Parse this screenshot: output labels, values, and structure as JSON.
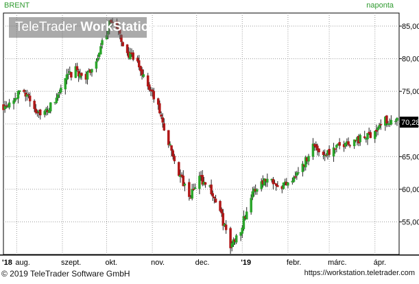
{
  "header": {
    "symbol": "BRENT",
    "period": "naponta"
  },
  "watermark": {
    "brand_light": "TeleTrader ",
    "brand_bold": "WorkStation"
  },
  "footer": {
    "copyright": "© 2019 TeleTrader Software GmbH",
    "url": "https://workstation.teletrader.com"
  },
  "colors": {
    "up": "#2aa52a",
    "down": "#b01818",
    "grid": "#9a9a9a",
    "axis": "#000000",
    "symbol": "#2e9a2e"
  },
  "chart_data": {
    "type": "candlestick",
    "ylim": [
      50,
      87
    ],
    "y_ticks": [
      {
        "value": 55,
        "label": "55,00"
      },
      {
        "value": 60,
        "label": "60,00"
      },
      {
        "value": 65,
        "label": "65,00"
      },
      {
        "value": 70,
        "label": "70,00"
      },
      {
        "value": 75,
        "label": "75,00"
      },
      {
        "value": 80,
        "label": "80,00"
      },
      {
        "value": 85,
        "label": "85,00"
      }
    ],
    "x_ticks": [
      {
        "date": "2018-07-23",
        "label": "'18",
        "bold": true
      },
      {
        "date": "2018-08-01",
        "label": "aug.",
        "bold": false
      },
      {
        "date": "2018-09-01",
        "label": "szept.",
        "bold": false
      },
      {
        "date": "2018-10-01",
        "label": "okt.",
        "bold": false
      },
      {
        "date": "2018-11-01",
        "label": "nov.",
        "bold": false
      },
      {
        "date": "2018-12-01",
        "label": "dec.",
        "bold": false
      },
      {
        "date": "2019-01-01",
        "label": "'19",
        "bold": true
      },
      {
        "date": "2019-02-01",
        "label": "febr.",
        "bold": false
      },
      {
        "date": "2019-03-01",
        "label": "márc.",
        "bold": false
      },
      {
        "date": "2019-04-01",
        "label": "ápr.",
        "bold": false
      }
    ],
    "x_range": [
      "2018-07-23",
      "2019-04-16"
    ],
    "last_price": {
      "value": 70.28,
      "label": "70,28"
    },
    "grid": true,
    "close_path": [
      [
        "2018-07-23",
        72.8
      ],
      [
        "2018-07-30",
        74.0
      ],
      [
        "2018-08-06",
        75.2
      ],
      [
        "2018-08-13",
        72.3
      ],
      [
        "2018-08-20",
        71.6
      ],
      [
        "2018-08-27",
        73.5
      ],
      [
        "2018-09-03",
        76.8
      ],
      [
        "2018-09-10",
        78.2
      ],
      [
        "2018-09-17",
        77.0
      ],
      [
        "2018-09-24",
        79.8
      ],
      [
        "2018-10-01",
        84.0
      ],
      [
        "2018-10-03",
        86.1
      ],
      [
        "2018-10-08",
        84.5
      ],
      [
        "2018-10-15",
        80.8
      ],
      [
        "2018-10-22",
        79.2
      ],
      [
        "2018-10-29",
        76.0
      ],
      [
        "2018-11-05",
        72.5
      ],
      [
        "2018-11-12",
        67.0
      ],
      [
        "2018-11-19",
        62.5
      ],
      [
        "2018-11-26",
        58.6
      ],
      [
        "2018-12-03",
        61.8
      ],
      [
        "2018-12-10",
        60.2
      ],
      [
        "2018-12-17",
        56.5
      ],
      [
        "2018-12-24",
        51.2
      ],
      [
        "2018-12-31",
        54.0
      ],
      [
        "2019-01-07",
        58.9
      ],
      [
        "2019-01-14",
        61.3
      ],
      [
        "2019-01-21",
        61.6
      ],
      [
        "2019-01-28",
        60.5
      ],
      [
        "2019-02-04",
        61.8
      ],
      [
        "2019-02-11",
        63.5
      ],
      [
        "2019-02-18",
        66.8
      ],
      [
        "2019-02-25",
        65.4
      ],
      [
        "2019-03-04",
        66.0
      ],
      [
        "2019-03-11",
        67.0
      ],
      [
        "2019-03-18",
        67.5
      ],
      [
        "2019-03-25",
        67.8
      ],
      [
        "2019-04-01",
        69.0
      ],
      [
        "2019-04-08",
        70.6
      ],
      [
        "2019-04-16",
        70.28
      ]
    ]
  }
}
